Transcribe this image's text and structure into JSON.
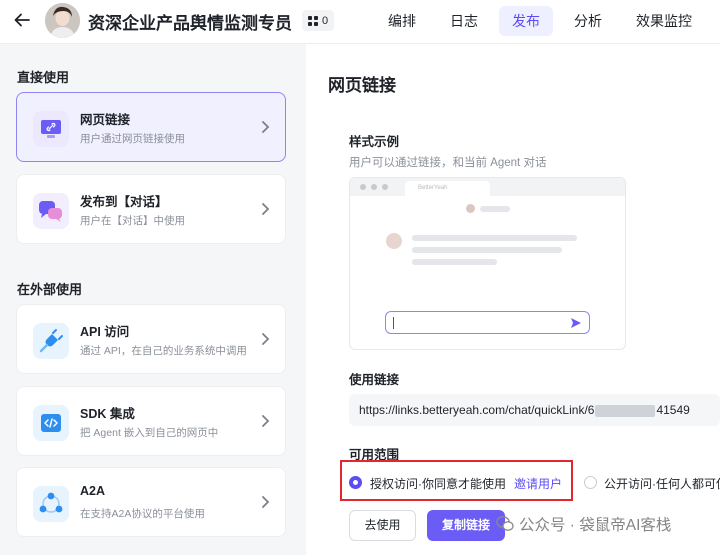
{
  "header": {
    "back_icon": "arrow-left-icon",
    "title": "资深企业产品舆情监测专员",
    "counter": "0",
    "tabs": [
      {
        "label": "编排",
        "active": false
      },
      {
        "label": "日志",
        "active": false
      },
      {
        "label": "发布",
        "active": true
      },
      {
        "label": "分析",
        "active": false
      },
      {
        "label": "效果监控",
        "active": false
      }
    ]
  },
  "sidebar": {
    "direct_section": "直接使用",
    "external_section": "在外部使用",
    "items": [
      {
        "title": "网页链接",
        "desc": "用户通过网页链接使用",
        "icon": "link-monitor-icon",
        "selected": true
      },
      {
        "title": "发布到【对话】",
        "desc": "用户在【对话】中使用",
        "icon": "chat-bubbles-icon",
        "selected": false
      },
      {
        "title": "API 访问",
        "desc": "通过 API，在自己的业务系统中调用",
        "icon": "plug-icon",
        "selected": false
      },
      {
        "title": "SDK 集成",
        "desc": "把 Agent 嵌入到自己的网页中",
        "icon": "code-icon",
        "selected": false
      },
      {
        "title": "A2A",
        "desc": "在支持A2A协议的平台使用",
        "icon": "network-icon",
        "selected": false
      }
    ]
  },
  "main": {
    "title": "网页链接",
    "example_label": "样式示例",
    "example_desc": "用户可以通过链接，和当前 Agent 对话",
    "preview_tab": "BetterYeah",
    "link_label": "使用链接",
    "link_prefix": "https://links.betteryeah.com/chat/quickLink/6",
    "link_suffix": "41549",
    "scope_label": "可用范围",
    "scope_options": [
      {
        "label": "授权访问·你同意才能使用",
        "selected": true
      },
      {
        "label": "公开访问·任何人都可使",
        "selected": false
      }
    ],
    "invite_label": "邀请用户",
    "go_button": "去使用",
    "copy_button": "复制链接"
  },
  "watermark": {
    "text": "公众号 · 袋鼠帝AI客栈"
  },
  "colors": {
    "accent": "#5b4cf5",
    "highlight_border": "#e0282e"
  }
}
